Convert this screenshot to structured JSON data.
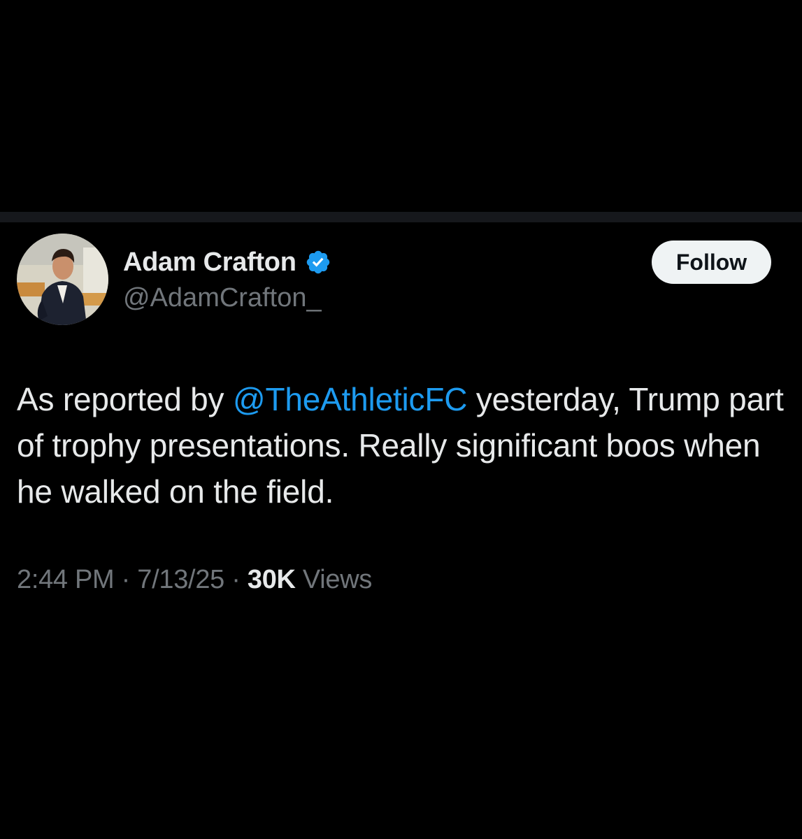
{
  "author": {
    "display_name": "Adam Crafton",
    "handle": "@AdamCrafton_",
    "verified": true,
    "avatar_icon": "profile-photo"
  },
  "follow_button": {
    "label": "Follow"
  },
  "tweet": {
    "text_before_mention": "As reported by ",
    "mention": "@TheAthleticFC",
    "text_after_mention": " yesterday, Trump part of trophy presentations. Really significant boos when he walked on the field."
  },
  "meta": {
    "time": "2:44 PM",
    "separator": " · ",
    "date": "7/13/25",
    "views_count": "30K",
    "views_label": " Views"
  },
  "colors": {
    "background": "#000000",
    "text_primary": "#e7e9ea",
    "text_secondary": "#71767b",
    "accent": "#1d9bf0",
    "follow_bg": "#eff3f4"
  }
}
